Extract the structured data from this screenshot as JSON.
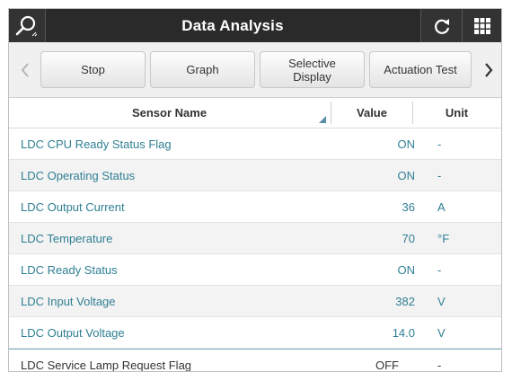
{
  "header": {
    "title": "Data Analysis",
    "search_icon": "search-icon",
    "refresh_icon": "refresh-icon",
    "menu_icon": "grid-menu-icon"
  },
  "toolbar": {
    "buttons": [
      {
        "label": "Stop"
      },
      {
        "label": "Graph"
      },
      {
        "label": "Selective\nDisplay"
      },
      {
        "label": "Actuation Test"
      }
    ],
    "prev_icon": "chevron-left-icon",
    "next_icon": "chevron-right-icon"
  },
  "table": {
    "columns": [
      "Sensor Name",
      "Value",
      "Unit"
    ],
    "rows": [
      {
        "name": "LDC CPU Ready Status Flag",
        "value": "ON",
        "unit": "-"
      },
      {
        "name": "LDC Operating Status",
        "value": "ON",
        "unit": "-"
      },
      {
        "name": "LDC Output Current",
        "value": "36",
        "unit": "A"
      },
      {
        "name": "LDC Temperature",
        "value": "70",
        "unit": "°F"
      },
      {
        "name": "LDC Ready Status",
        "value": "ON",
        "unit": "-"
      },
      {
        "name": "LDC Input Voltage",
        "value": "382",
        "unit": "V"
      },
      {
        "name": "LDC Output Voltage",
        "value": "14.0",
        "unit": "V"
      },
      {
        "name": "LDC Service Lamp Request Flag",
        "value": "OFF",
        "unit": "-"
      }
    ]
  },
  "colors": {
    "header_bg": "#2a2a2a",
    "selected_text": "#2f7f93",
    "sort_indicator": "#5a8ea6"
  }
}
